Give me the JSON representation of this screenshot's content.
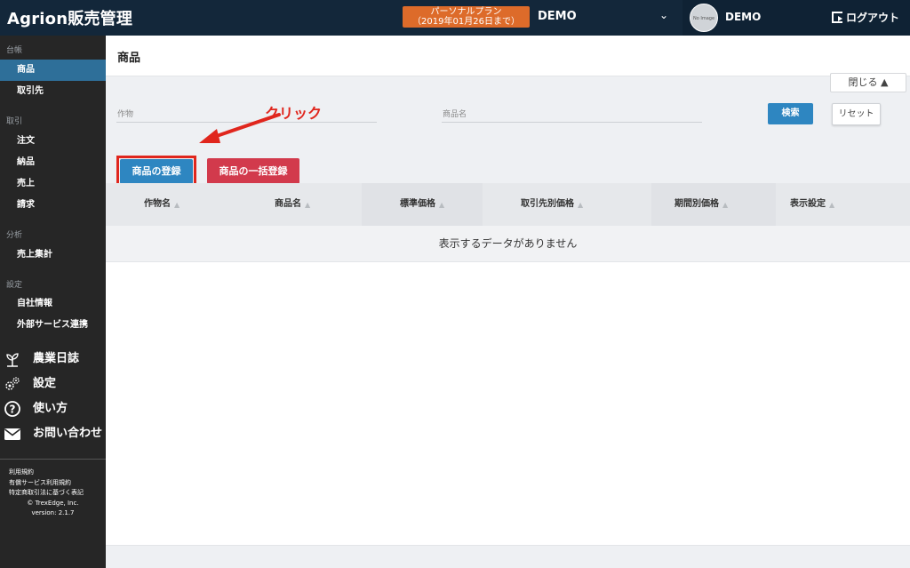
{
  "header": {
    "logo": "Agrion販売管理",
    "plan_line1": "パーソナルプラン",
    "plan_line2": "（2019年01月26日まで）",
    "account_name": "DEMO",
    "avatar_text": "No Image",
    "user_name": "DEMO",
    "logout_label": "ログアウト"
  },
  "sidebar": {
    "sections": [
      {
        "label": "台帳",
        "items": [
          {
            "label": "商品",
            "active": true
          },
          {
            "label": "取引先"
          }
        ]
      },
      {
        "label": "取引",
        "items": [
          {
            "label": "注文"
          },
          {
            "label": "納品"
          },
          {
            "label": "売上"
          },
          {
            "label": "請求"
          }
        ]
      },
      {
        "label": "分析",
        "items": [
          {
            "label": "売上集計"
          }
        ]
      },
      {
        "label": "設定",
        "items": [
          {
            "label": "自社情報"
          },
          {
            "label": "外部サービス連携"
          }
        ]
      }
    ],
    "big_items": [
      {
        "label": "農業日誌",
        "icon": "sprout-icon"
      },
      {
        "label": "設定",
        "icon": "gears-icon"
      },
      {
        "label": "使い方",
        "icon": "question-circle-icon"
      },
      {
        "label": "お問い合わせ",
        "icon": "envelope-icon"
      }
    ],
    "footer": {
      "terms": "利用規約",
      "paid_terms": "有償サービス利用規約",
      "commerce_law": "特定商取引法に基づく表記",
      "copyright": "© TrexEdge, Inc.",
      "version": "version: 2.1.7"
    }
  },
  "main": {
    "page_title": "商品",
    "search": {
      "close_label": "閉じる ▲",
      "crop_label": "作物",
      "product_label": "商品名",
      "search_button": "検索",
      "reset_button": "リセット"
    },
    "actions": {
      "register_button": "商品の登録",
      "bulk_register_button": "商品の一括登録",
      "annotation": "クリック"
    },
    "table": {
      "columns": [
        "作物名",
        "商品名",
        "標準価格",
        "取引先別価格",
        "期間別価格",
        "表示設定"
      ],
      "empty_message": "表示するデータがありません"
    }
  },
  "colors": {
    "header_bg": "#13273a",
    "sidebar_bg": "#262626",
    "sidebar_active": "#2e6f99",
    "plan_badge": "#dd6b2a",
    "primary_button": "#2e86c1",
    "danger_button": "#d23a4c",
    "annotation_red": "#e0261d"
  }
}
